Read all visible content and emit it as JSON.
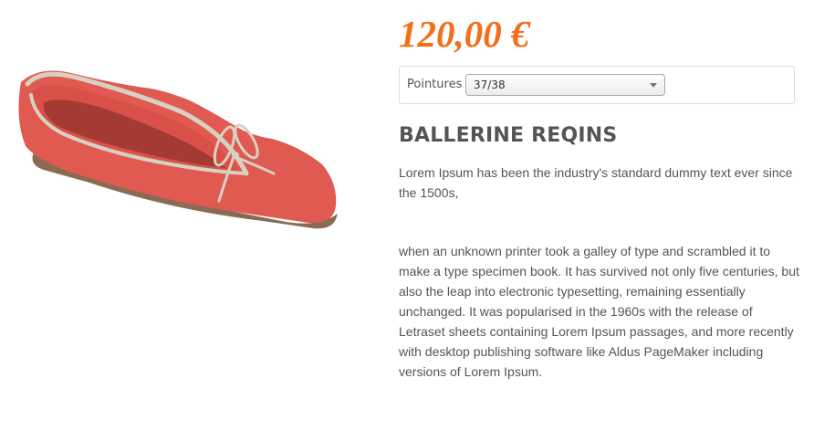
{
  "product": {
    "price": "120,00 €",
    "size_label": "Pointures",
    "size_selected": "37/38",
    "title": "BALLERINE REQINS",
    "description": [
      "Lorem Ipsum has been the industry's standard dummy text ever since the 1500s,",
      "when an unknown printer took a galley of type and scrambled it to make a type specimen book. It has survived not only five centuries, but also the leap into electronic typesetting, remaining essentially unchanged. It was popularised in the 1960s with the release of Letraset sheets containing Lorem Ipsum passages, and more recently with desktop publishing software like Aldus PageMaker including versions of Lorem Ipsum."
    ]
  },
  "colors": {
    "price": "#f36f1c",
    "shoe_body": "#e05a52",
    "shoe_trim": "#d8d1c3",
    "text": "#555555"
  },
  "icons": {
    "product_image": "red-ballerina-flat-shoe",
    "select_arrow": "chevron-down-icon"
  }
}
